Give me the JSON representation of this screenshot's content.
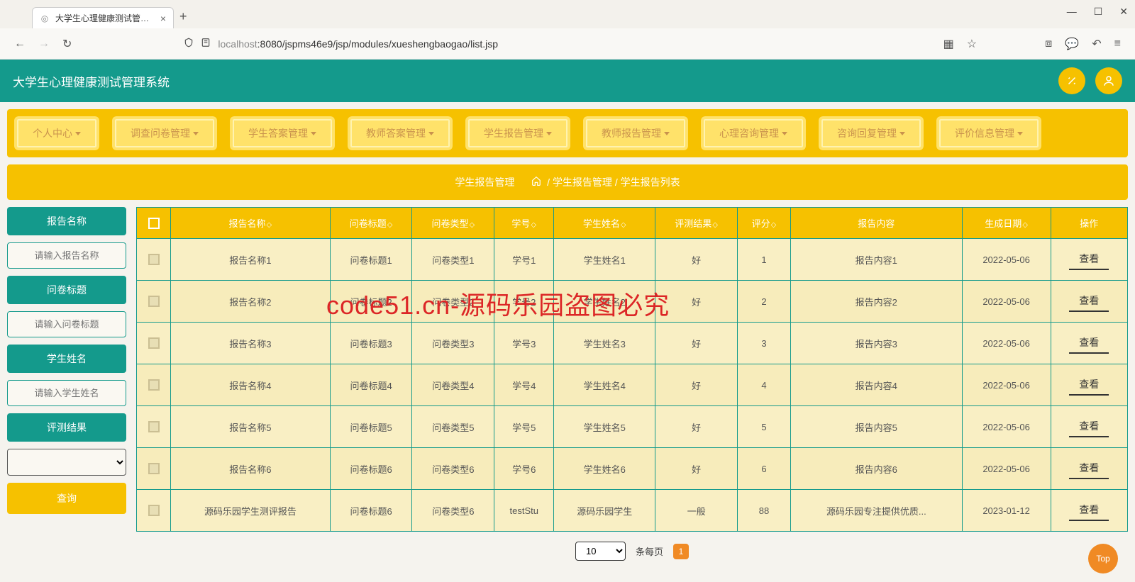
{
  "browser": {
    "tab_title": "大学生心理健康测试管理系统",
    "url_host": "localhost",
    "url_path": ":8080/jspms46e9/jsp/modules/xueshengbaogao/list.jsp"
  },
  "app": {
    "title": "大学生心理健康测试管理系统"
  },
  "menu": {
    "items": [
      "个人中心",
      "调查问卷管理",
      "学生答案管理",
      "教师答案管理",
      "学生报告管理",
      "教师报告管理",
      "心理咨询管理",
      "咨询回复管理",
      "评价信息管理"
    ]
  },
  "breadcrumb": {
    "page": "学生报告管理",
    "path1": "学生报告管理",
    "path2": "学生报告列表"
  },
  "side": {
    "labels": [
      "报告名称",
      "问卷标题",
      "学生姓名",
      "评测结果"
    ],
    "placeholders": [
      "请输入报告名称",
      "请输入问卷标题",
      "请输入学生姓名"
    ],
    "query": "查询"
  },
  "table": {
    "headers": [
      "报告名称",
      "问卷标题",
      "问卷类型",
      "学号",
      "学生姓名",
      "评测结果",
      "评分",
      "报告内容",
      "生成日期",
      "操作"
    ],
    "action_label": "查看",
    "rows": [
      {
        "c": [
          "报告名称1",
          "问卷标题1",
          "问卷类型1",
          "学号1",
          "学生姓名1",
          "好",
          "1",
          "报告内容1",
          "2022-05-06"
        ]
      },
      {
        "c": [
          "报告名称2",
          "问卷标题2",
          "问卷类型2",
          "学号2",
          "学生姓名2",
          "好",
          "2",
          "报告内容2",
          "2022-05-06"
        ]
      },
      {
        "c": [
          "报告名称3",
          "问卷标题3",
          "问卷类型3",
          "学号3",
          "学生姓名3",
          "好",
          "3",
          "报告内容3",
          "2022-05-06"
        ]
      },
      {
        "c": [
          "报告名称4",
          "问卷标题4",
          "问卷类型4",
          "学号4",
          "学生姓名4",
          "好",
          "4",
          "报告内容4",
          "2022-05-06"
        ]
      },
      {
        "c": [
          "报告名称5",
          "问卷标题5",
          "问卷类型5",
          "学号5",
          "学生姓名5",
          "好",
          "5",
          "报告内容5",
          "2022-05-06"
        ]
      },
      {
        "c": [
          "报告名称6",
          "问卷标题6",
          "问卷类型6",
          "学号6",
          "学生姓名6",
          "好",
          "6",
          "报告内容6",
          "2022-05-06"
        ]
      },
      {
        "c": [
          "源码乐园学生测评报告",
          "问卷标题6",
          "问卷类型6",
          "testStu",
          "源码乐园学生",
          "一般",
          "88",
          "源码乐园专注提供优质...",
          "2023-01-12"
        ]
      }
    ]
  },
  "pager": {
    "size": "10",
    "label": "条每页",
    "current": "1"
  },
  "fab": "Top",
  "watermark": "code51.cn-源码乐园盗图必究"
}
